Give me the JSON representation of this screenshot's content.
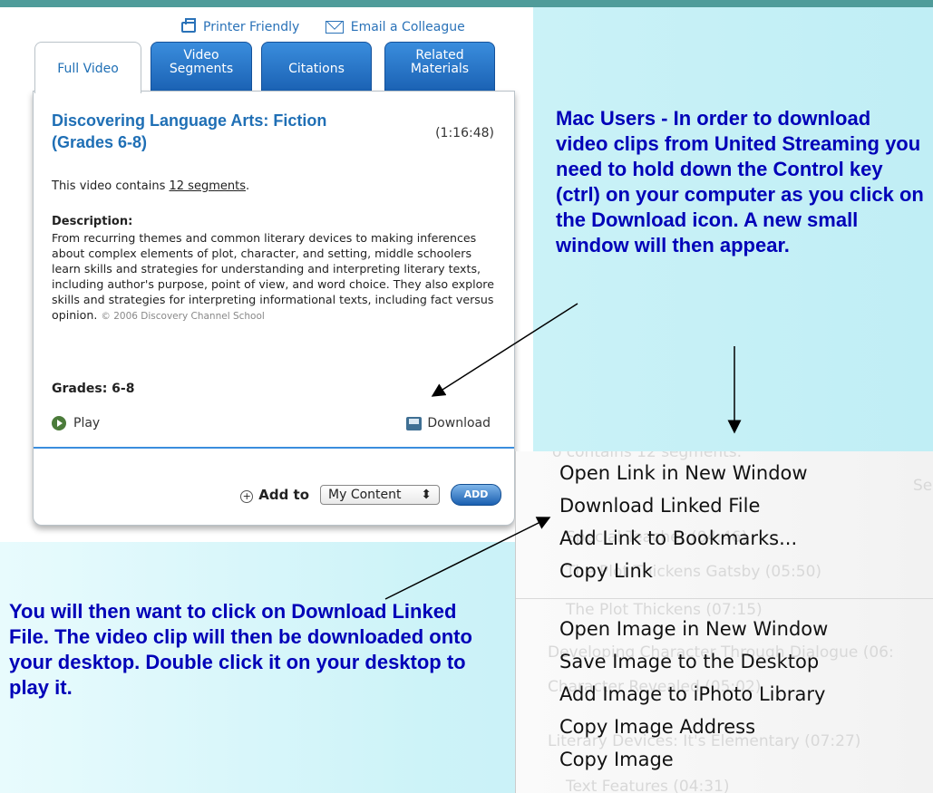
{
  "toolbar": {
    "printer_friendly": "Printer Friendly",
    "email_colleague": "Email a Colleague"
  },
  "tabs": [
    {
      "line1": "Full Video",
      "line2": ""
    },
    {
      "line1": "Video",
      "line2": "Segments"
    },
    {
      "line1": "Citations",
      "line2": ""
    },
    {
      "line1": "Related",
      "line2": "Materials"
    }
  ],
  "video": {
    "title": "Discovering Language Arts: Fiction (Grades 6-8)",
    "duration": "(1:16:48)",
    "contains_prefix": "This video contains ",
    "contains_link": "12 segments",
    "contains_suffix": ".",
    "description_label": "Description:",
    "description": "From recurring themes and common literary devices to making inferences about complex elements of plot, character, and setting, middle schoolers learn skills and strategies for understanding and interpreting literary texts, including author's purpose, point of view, and word choice. They also explore skills and strategies for interpreting informational texts, including fact versus opinion.",
    "copyright": "© 2006 Discovery Channel School",
    "grades": "Grades: 6-8",
    "play_label": "Play",
    "download_label": "Download",
    "add_to_label": "Add to",
    "add_to_select_value": "My Content",
    "add_button": "ADD"
  },
  "callouts": {
    "mac_users": "Mac Users - In order to download video clips from United Streaming you need to hold down the Control key (ctrl) on your computer as you click on the Download icon.  A new small window will then appear.",
    "download_linked": "You will then want to click on Download Linked File.  The video clip will then be downloaded onto your desktop.  Double click it on your desktop to play it."
  },
  "context_menu": {
    "ghost_text": [
      "o contains 12 segments.",
      "Se",
      "Special Teacher (04:46)",
      "The Plot Thickens Gatsby (05:50)",
      "The Plot Thickens (07:15)",
      "Developing Character Through Dialogue (06:",
      "Character Revealed (05:02)",
      "Literary Devices: It's Elementary (07:27)",
      "Text Features (04:31)"
    ],
    "group1": [
      "Open Link in New Window",
      "Download Linked File",
      "Add Link to Bookmarks...",
      "Copy Link"
    ],
    "group2": [
      "Open Image in New Window",
      "Save Image to the Desktop",
      "Add Image to iPhoto Library",
      "Copy Image Address",
      "Copy Image"
    ]
  },
  "colors": {
    "accent_blue": "#1f6fb5",
    "callout_text": "#0000b8",
    "top_bar": "#4f9c9a"
  }
}
